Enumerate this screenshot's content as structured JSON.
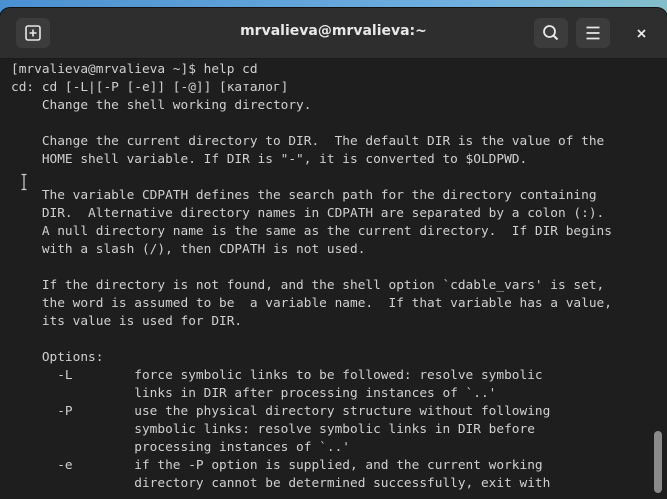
{
  "window": {
    "title": "mrvalieva@mrvalieva:~"
  },
  "icons": {
    "new_tab": "new-tab-plus-icon",
    "search": "search-icon",
    "menu": "hamburger-menu-icon",
    "close": "close-icon"
  },
  "colors": {
    "terminal_bg": "#1e1e1e",
    "terminal_fg": "#d0d0d0",
    "titlebar_bg": "#2e2e2e"
  },
  "terminal": {
    "lines": [
      "[mrvalieva@mrvalieva ~]$ help cd",
      "cd: cd [-L|[-P [-e]] [-@]] [каталог]",
      "    Change the shell working directory.",
      "",
      "    Change the current directory to DIR.  The default DIR is the value of the",
      "    HOME shell variable. If DIR is \"-\", it is converted to $OLDPWD.",
      "",
      "    The variable CDPATH defines the search path for the directory containing",
      "    DIR.  Alternative directory names in CDPATH are separated by a colon (:).",
      "    A null directory name is the same as the current directory.  If DIR begins",
      "    with a slash (/), then CDPATH is not used.",
      "",
      "    If the directory is not found, and the shell option `cdable_vars' is set,",
      "    the word is assumed to be  a variable name.  If that variable has a value,",
      "    its value is used for DIR.",
      "",
      "    Options:",
      "      -L        force symbolic links to be followed: resolve symbolic",
      "                links in DIR after processing instances of `..'",
      "      -P        use the physical directory structure without following",
      "                symbolic links: resolve symbolic links in DIR before",
      "                processing instances of `..'",
      "      -e        if the -P option is supplied, and the current working",
      "                directory cannot be determined successfully, exit with"
    ]
  }
}
